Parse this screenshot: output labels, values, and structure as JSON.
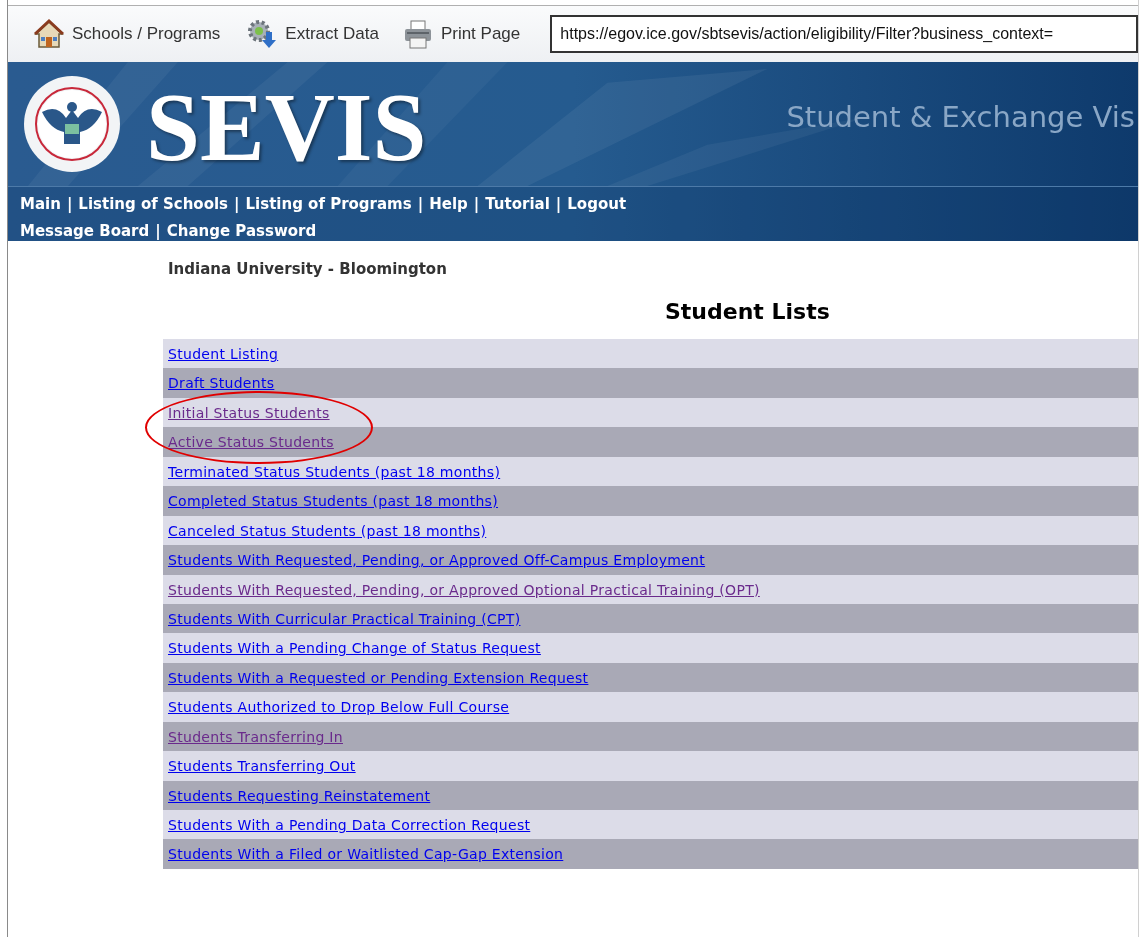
{
  "toolbar": {
    "buttons": [
      {
        "label": "Schools / Programs",
        "kind": "home"
      },
      {
        "label": "Extract Data",
        "kind": "extract"
      },
      {
        "label": "Print Page",
        "kind": "print"
      }
    ],
    "address": "https://egov.ice.gov/sbtsevis/action/eligibility/Filter?business_context="
  },
  "header": {
    "title": "SEVIS",
    "subtitle": "Student & Exchange Vis",
    "separator": "|",
    "nav": [
      [
        "Main",
        "Listing of Schools",
        "Listing of Programs",
        "Help",
        "Tutorial",
        "Logout"
      ],
      [
        "Message Board",
        "Change Password"
      ]
    ]
  },
  "school": "Indiana University - Bloomington",
  "heading": "Student Lists",
  "lists": [
    {
      "label": "Student Listing",
      "visited": false,
      "circled": false
    },
    {
      "label": "Draft Students",
      "visited": false,
      "circled": false
    },
    {
      "label": "Initial Status Students",
      "visited": true,
      "circled": true
    },
    {
      "label": "Active Status Students",
      "visited": true,
      "circled": true
    },
    {
      "label": "Terminated Status Students (past 18 months)",
      "visited": false,
      "circled": false
    },
    {
      "label": "Completed Status Students (past 18 months)",
      "visited": false,
      "circled": false
    },
    {
      "label": "Canceled Status Students (past 18 months)",
      "visited": false,
      "circled": false
    },
    {
      "label": "Students With Requested, Pending, or Approved Off-Campus Employment",
      "visited": false,
      "circled": false
    },
    {
      "label": "Students With Requested, Pending, or Approved Optional Practical Training (OPT)",
      "visited": true,
      "circled": false
    },
    {
      "label": "Students With Curricular Practical Training (CPT)",
      "visited": false,
      "circled": false
    },
    {
      "label": "Students With a Pending Change of Status Request",
      "visited": false,
      "circled": false
    },
    {
      "label": "Students With a Requested or Pending Extension Request",
      "visited": false,
      "circled": false
    },
    {
      "label": "Students Authorized to Drop Below Full Course",
      "visited": false,
      "circled": false
    },
    {
      "label": "Students Transferring In",
      "visited": true,
      "circled": false
    },
    {
      "label": "Students Transferring Out",
      "visited": false,
      "circled": false
    },
    {
      "label": "Students Requesting Reinstatement",
      "visited": false,
      "circled": false
    },
    {
      "label": "Students With a Pending Data Correction Request",
      "visited": false,
      "circled": false
    },
    {
      "label": "Students With a Filed or Waitlisted Cap-Gap Extension",
      "visited": false,
      "circled": false
    }
  ]
}
